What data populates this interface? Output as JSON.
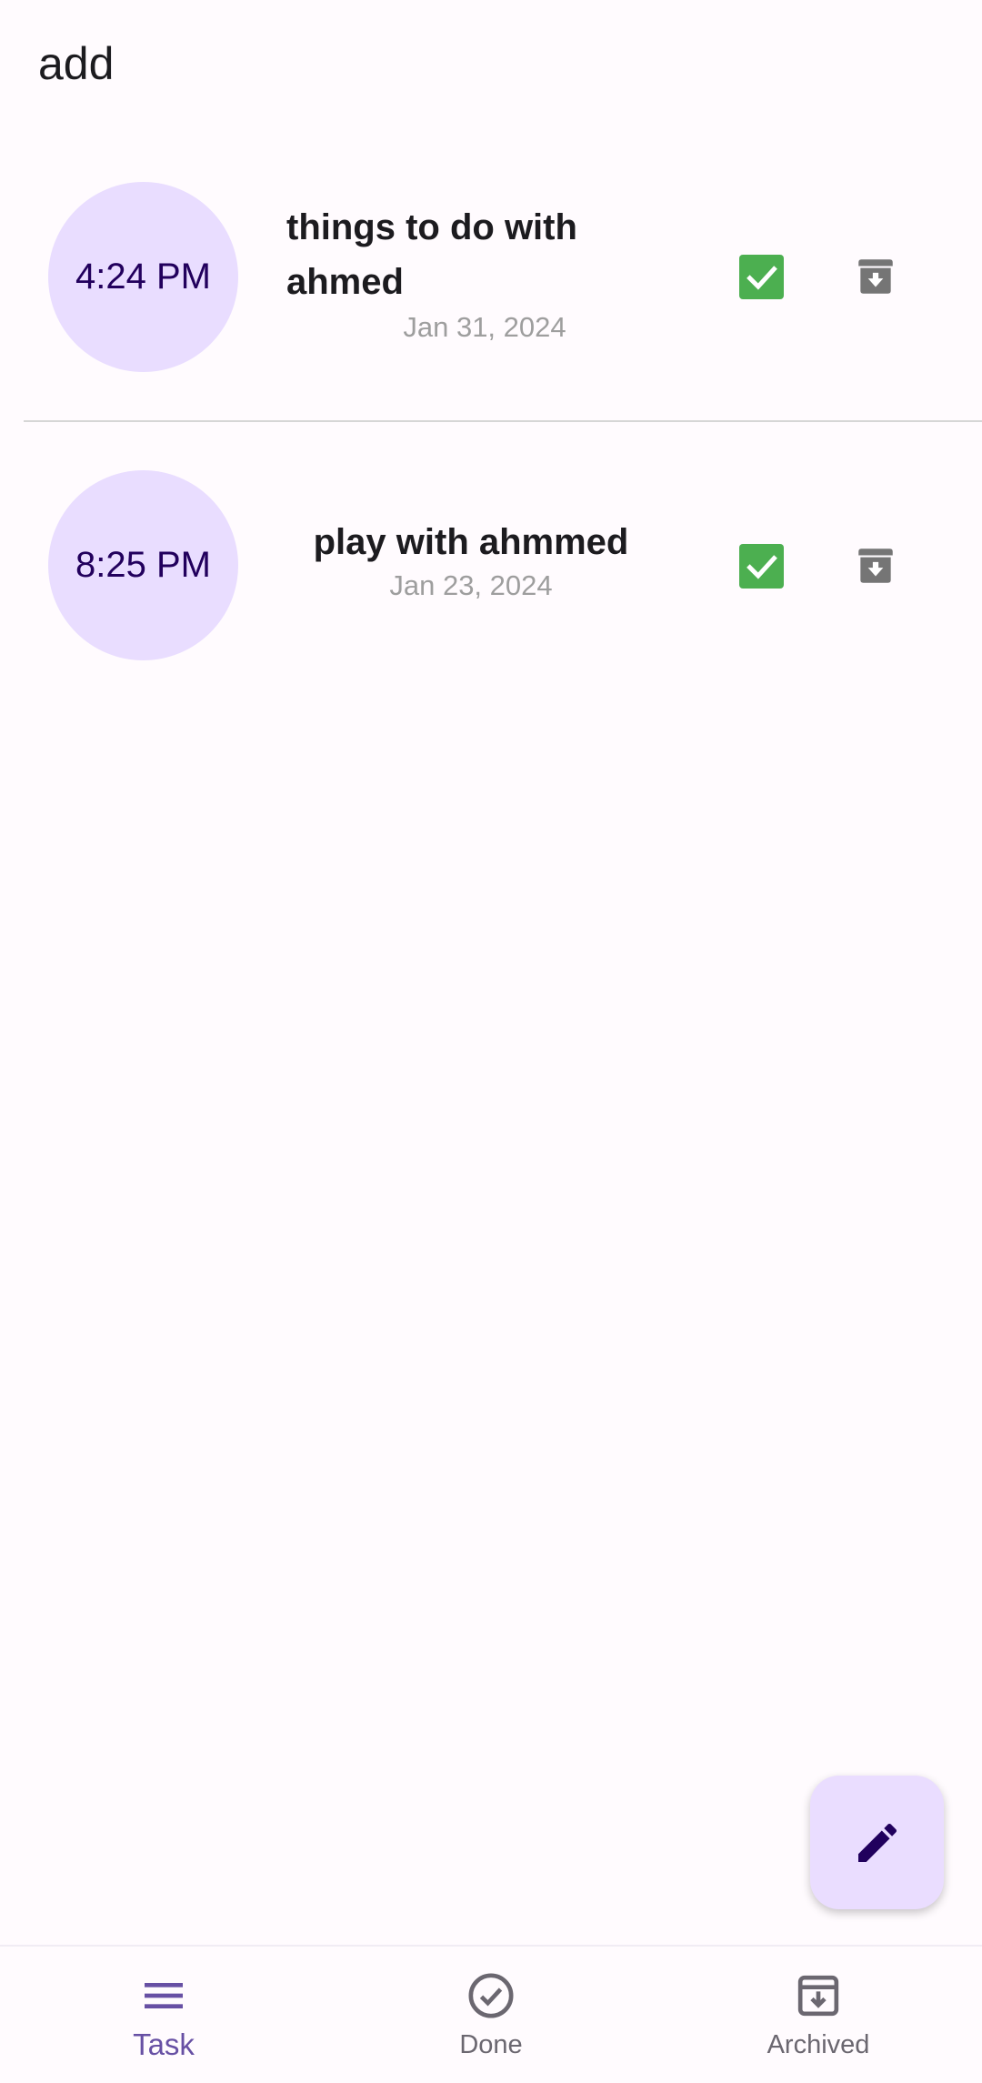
{
  "app_bar": {
    "title": "add"
  },
  "tasks": [
    {
      "time": "4:24 PM",
      "title": "things to do with ahmed",
      "date": "Jan 31, 2024",
      "done": true,
      "icons": {
        "check": "checkbox-checked-icon",
        "archive": "archive-icon"
      }
    },
    {
      "time": "8:25 PM",
      "title": "play with ahmmed",
      "date": "Jan 23, 2024",
      "done": true,
      "icons": {
        "check": "checkbox-checked-icon",
        "archive": "archive-icon"
      }
    }
  ],
  "fab": {
    "icon": "edit-icon"
  },
  "bottom_nav": {
    "items": [
      {
        "label": "Task",
        "icon": "menu-icon",
        "active": true
      },
      {
        "label": "Done",
        "icon": "check-circle-icon",
        "active": false
      },
      {
        "label": "Archived",
        "icon": "archive-outline-icon",
        "active": false
      }
    ]
  },
  "colors": {
    "background": "#fffbfe",
    "circle": "#e9ddff",
    "circle_text": "#22005d",
    "checkbox": "#4caf50",
    "archive_icon": "#757575",
    "accent": "#6750a4",
    "fab": "#eaddff",
    "date_text": "#9e9e9e",
    "divider": "#d6d6d6"
  }
}
